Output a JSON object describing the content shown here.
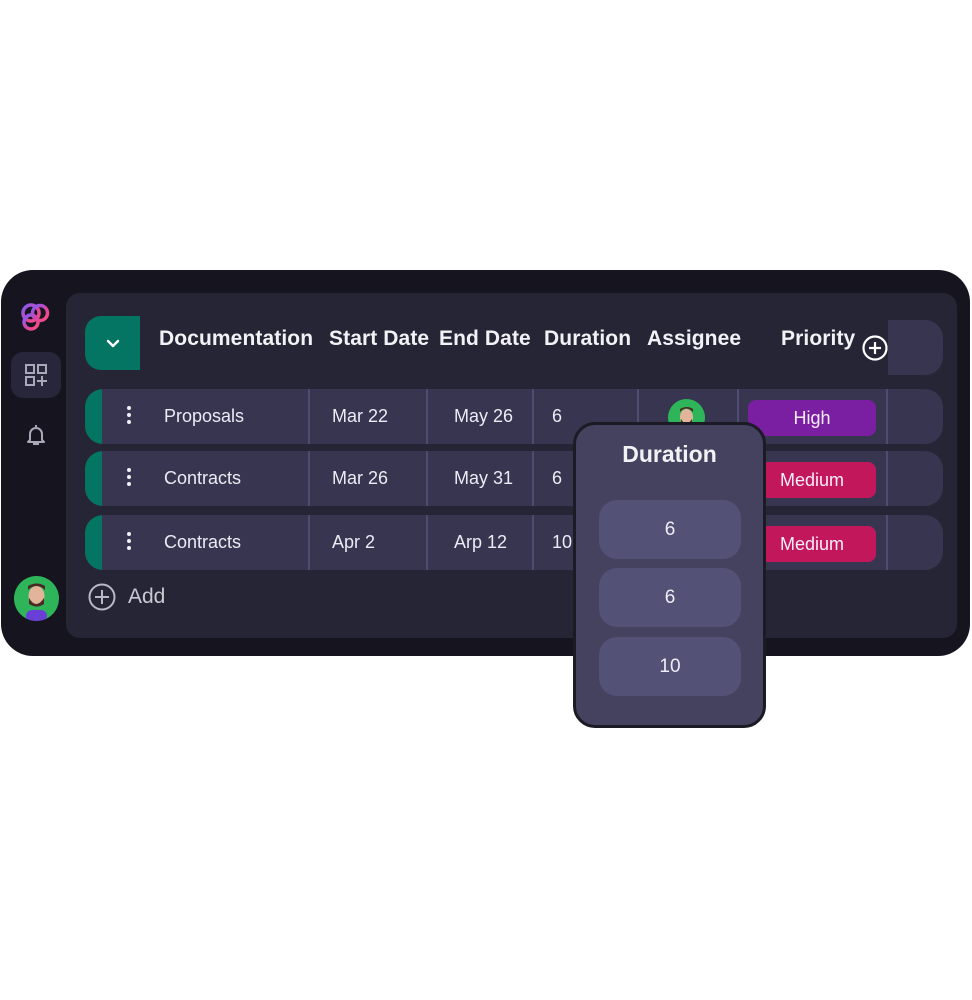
{
  "sidebar": {
    "logo": "brand-logo",
    "items": [
      {
        "icon": "add-widget-icon",
        "active": true
      },
      {
        "icon": "bell-icon",
        "active": false
      }
    ],
    "user_avatar": "user-avatar"
  },
  "table": {
    "group_toggle_icon": "chevron-down-icon",
    "columns": [
      "Documentation",
      "Start Date",
      "End Date",
      "Duration",
      "Assignee",
      "Priority"
    ],
    "add_column_icon": "plus-circle-icon",
    "rows": [
      {
        "name": "Proposals",
        "start": "Mar 22",
        "end": "May 26",
        "duration": "6",
        "assignee": "avatar",
        "priority": "High",
        "priority_color": "#7b1fa2"
      },
      {
        "name": "Contracts",
        "start": "Mar 26",
        "end": "May 31",
        "duration": "6",
        "assignee": "",
        "priority": "Medium",
        "priority_color": "#c2185b"
      },
      {
        "name": "Contracts",
        "start": "Apr 2",
        "end": "Arp 12",
        "duration": "10",
        "assignee": "",
        "priority": "Medium",
        "priority_color": "#c2185b"
      }
    ],
    "add_label": "Add"
  },
  "popup": {
    "title": "Duration",
    "options": [
      "6",
      "6",
      "10"
    ]
  },
  "colors": {
    "accent": "#047563",
    "high": "#7b1fa2",
    "medium": "#c2185b"
  }
}
